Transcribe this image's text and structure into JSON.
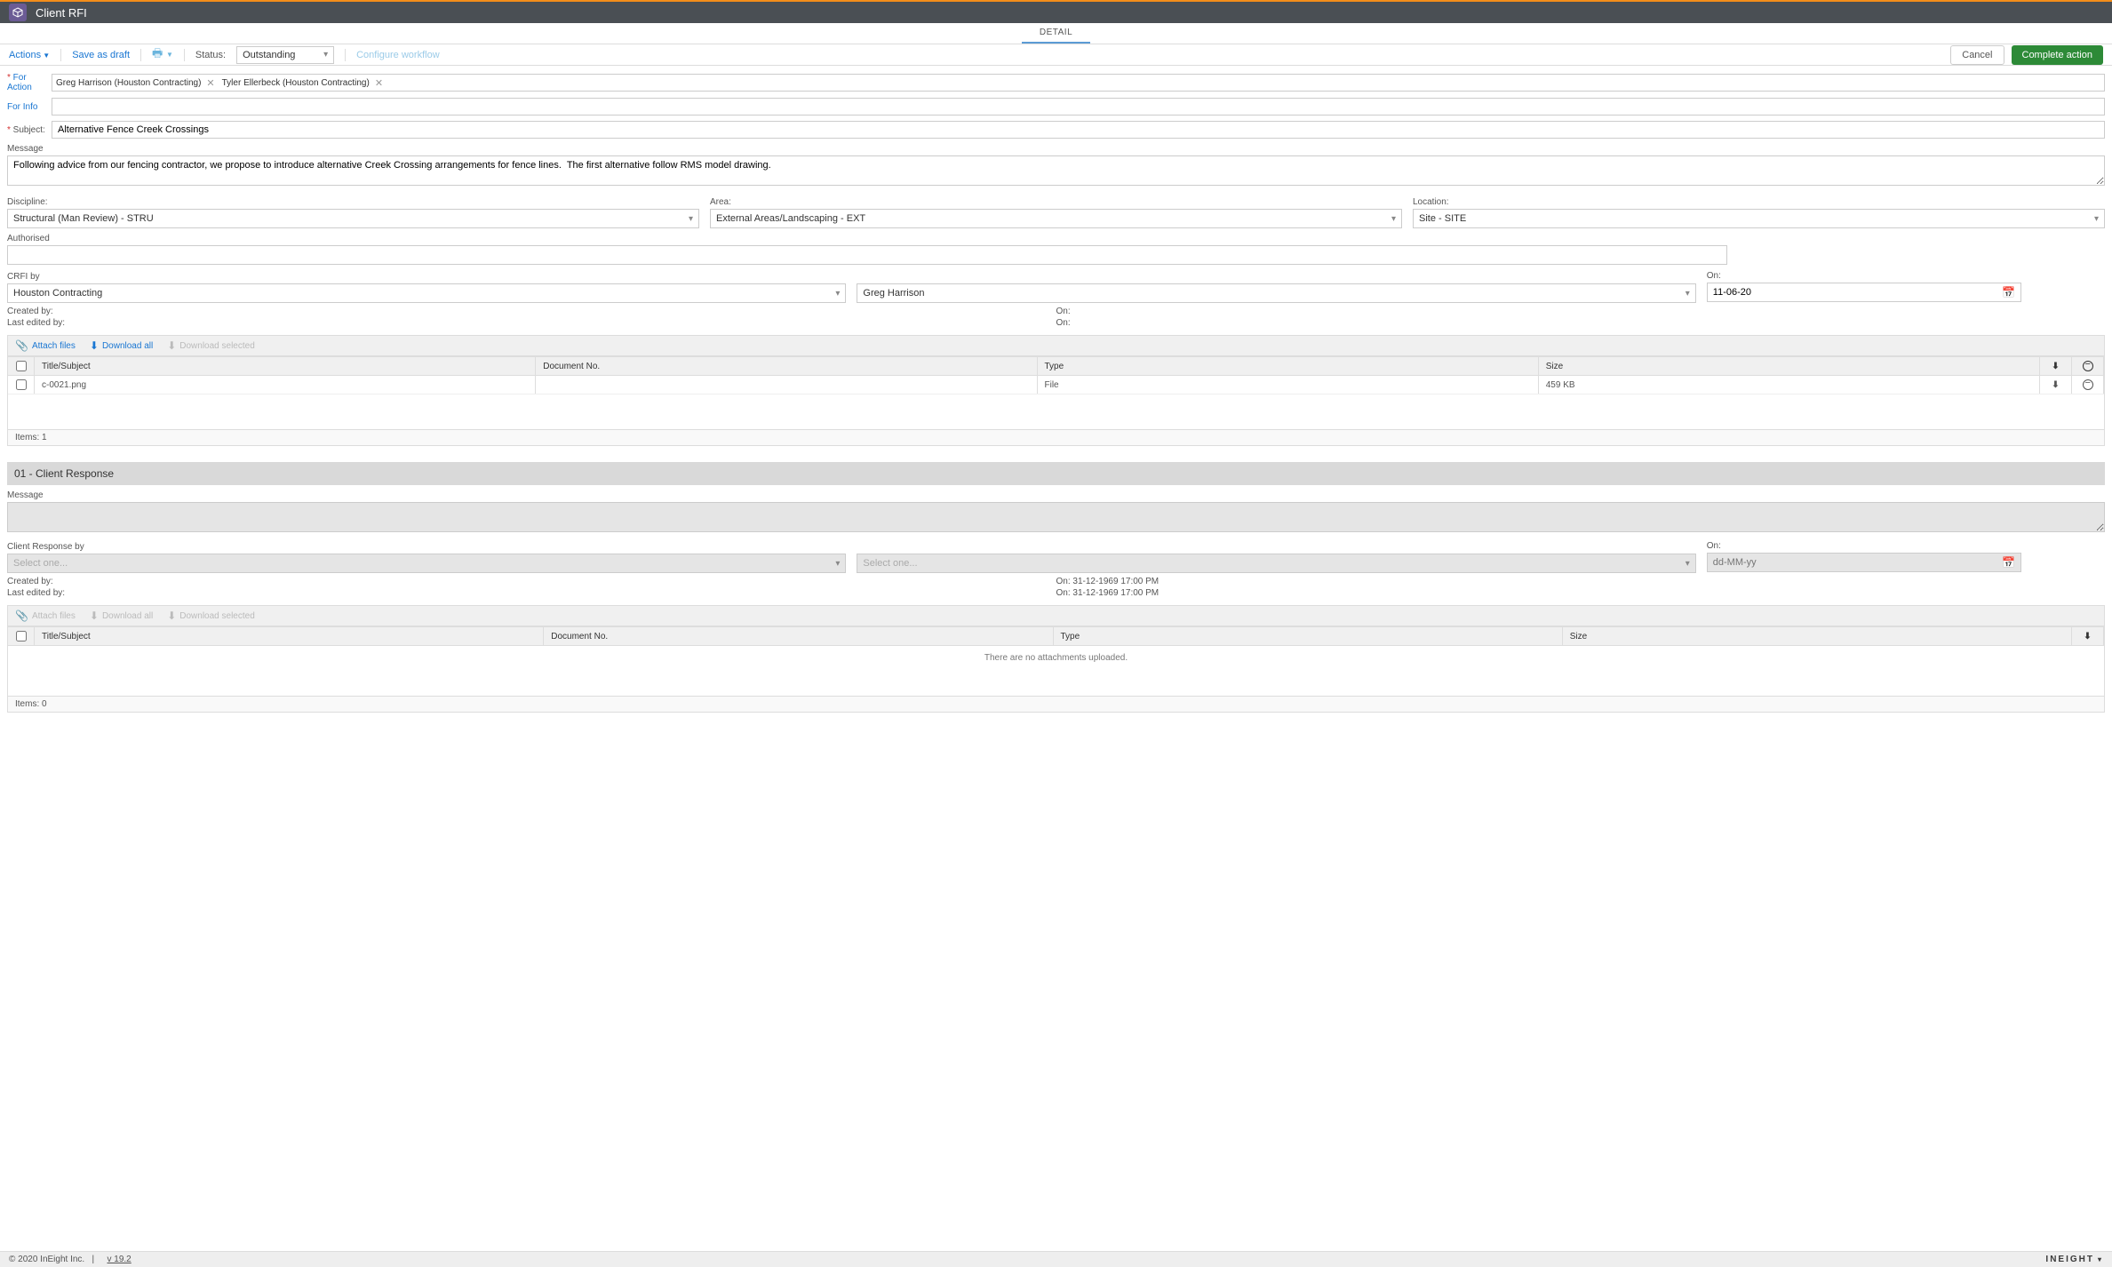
{
  "header": {
    "title": "Client RFI"
  },
  "tab": {
    "label": "DETAIL"
  },
  "toolbar": {
    "actions": "Actions",
    "save_draft": "Save as draft",
    "status_label": "Status:",
    "status_value": "Outstanding",
    "configure": "Configure workflow",
    "cancel": "Cancel",
    "complete": "Complete action"
  },
  "for_action": {
    "label": "For Action",
    "chips": [
      {
        "text": "Greg Harrison (Houston Contracting)"
      },
      {
        "text": "Tyler Ellerbeck (Houston Contracting)"
      }
    ]
  },
  "for_info": {
    "label": "For Info"
  },
  "subject": {
    "label": "Subject:",
    "value": "Alternative Fence Creek Crossings"
  },
  "message": {
    "label": "Message",
    "value": "Following advice from our fencing contractor, we propose to introduce alternative Creek Crossing arrangements for fence lines.  The first alternative follow RMS model drawing."
  },
  "discipline": {
    "label": "Discipline:",
    "value": "Structural (Man Review) - STRU"
  },
  "area": {
    "label": "Area:",
    "value": "External Areas/Landscaping - EXT"
  },
  "location": {
    "label": "Location:",
    "value": "Site - SITE"
  },
  "authorised": {
    "label": "Authorised"
  },
  "crfi": {
    "label": "CRFI by",
    "org": "Houston Contracting",
    "person": "Greg Harrison",
    "on_label": "On:",
    "on_value": "11-06-20"
  },
  "meta1": {
    "created_by": "Created by:",
    "last_edited": "Last edited by:",
    "on": "On:"
  },
  "attbar": {
    "attach": "Attach files",
    "download_all": "Download all",
    "download_selected": "Download selected"
  },
  "att_table": {
    "cols": {
      "title": "Title/Subject",
      "docno": "Document No.",
      "type": "Type",
      "size": "Size"
    },
    "rows": [
      {
        "title": "c-0021.png",
        "docno": "",
        "type": "File",
        "size": "459 KB"
      }
    ],
    "items": "Items: 1"
  },
  "response": {
    "header": "01 - Client Response",
    "message_label": "Message",
    "by_label": "Client Response by",
    "select_placeholder": "Select one...",
    "on_label": "On:",
    "date_placeholder": "dd-MM-yy",
    "created_by": "Created by:",
    "created_on": "On: 31-12-1969 17:00 PM",
    "edited_by": "Last edited by:",
    "edited_on": "On: 31-12-1969 17:00 PM"
  },
  "att_table2": {
    "cols": {
      "title": "Title/Subject",
      "docno": "Document No.",
      "type": "Type",
      "size": "Size"
    },
    "empty": "There are no attachments uploaded.",
    "items": "Items: 0"
  },
  "footer": {
    "copyright": "© 2020 InEight Inc.",
    "sep": "|",
    "version": "v 19.2",
    "brand": "INEIGHT"
  }
}
